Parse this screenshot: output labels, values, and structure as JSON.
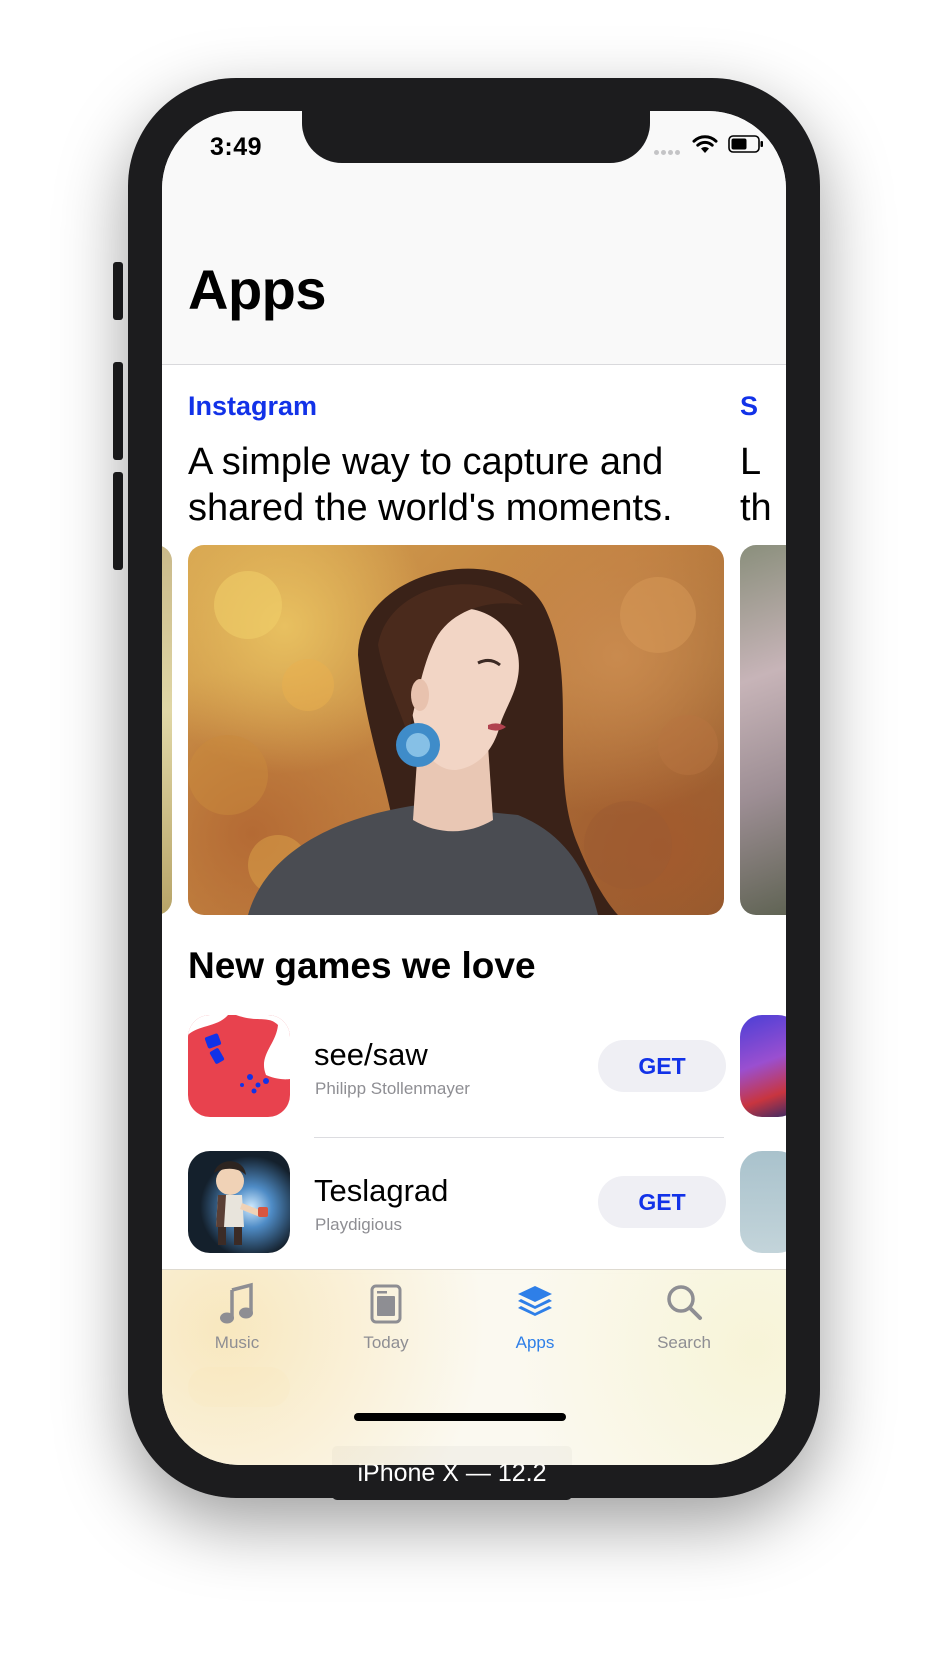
{
  "status_bar": {
    "time": "3:49"
  },
  "header": {
    "title": "Apps"
  },
  "featured": {
    "source": "Instagram",
    "headline": "A simple way to capture and shared the world's moments.",
    "next_source": "S",
    "next_headline_lines": [
      "L",
      "th"
    ]
  },
  "section": {
    "title": "New games we love"
  },
  "games": [
    {
      "name": "see/saw",
      "developer": "Philipp Stollenmayer",
      "action": "GET",
      "icon": "see-saw-icon"
    },
    {
      "name": "Teslagrad",
      "developer": "Playdigious",
      "action": "GET",
      "icon": "teslagrad-icon"
    }
  ],
  "tab_bar": {
    "items": [
      {
        "label": "Music",
        "icon": "music-note-icon",
        "active": false
      },
      {
        "label": "Today",
        "icon": "today-icon",
        "active": false
      },
      {
        "label": "Apps",
        "icon": "apps-stack-icon",
        "active": true
      },
      {
        "label": "Search",
        "icon": "search-icon",
        "active": false
      }
    ]
  },
  "device_label": "iPhone X — 12.2",
  "colors": {
    "accent_blue": "#1232e8",
    "tab_active": "#2e7fe8",
    "tab_inactive": "#8e8e93",
    "see_saw_red": "#e8424e"
  }
}
